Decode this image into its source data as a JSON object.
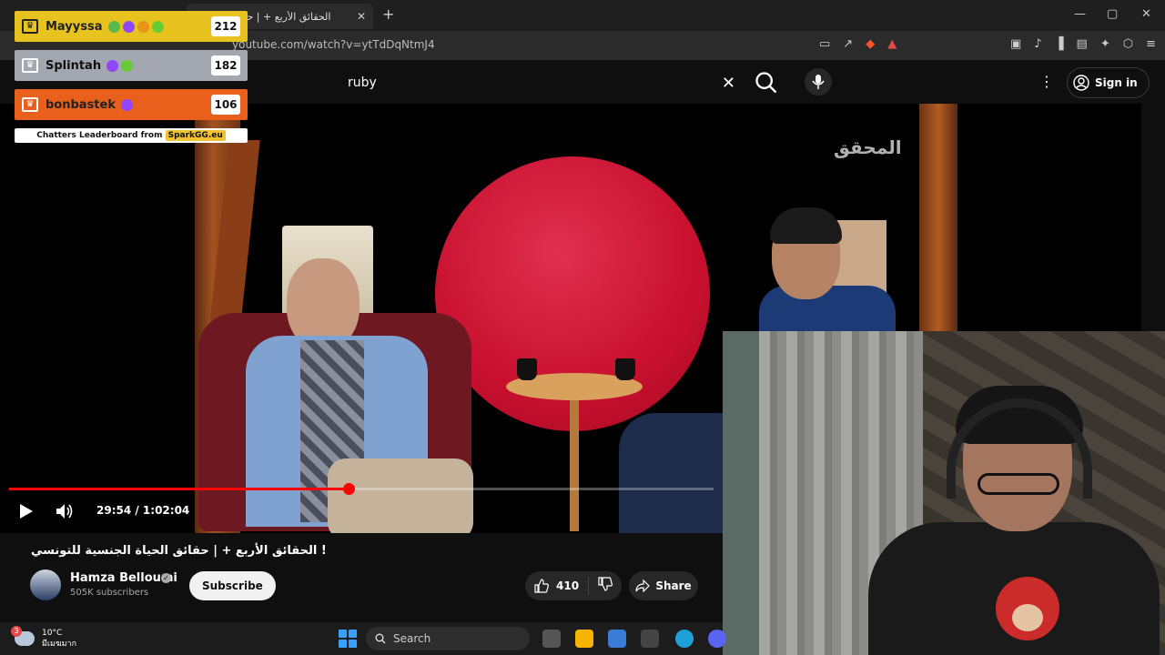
{
  "browser": {
    "tab_title": "! الحقائق الأربع + | حقائق الحياة",
    "tab_close": "✕",
    "new_tab": "+",
    "url": "youtube.com/watch?v=ytTdDqNtmJ4",
    "window_controls": {
      "minimize": "—",
      "maximize": "▢",
      "close": "✕"
    }
  },
  "youtube": {
    "search_value": "ruby",
    "search_placeholder": "Search",
    "sign_in": "Sign in"
  },
  "player": {
    "time": "29:54 / 1:02:04",
    "progress_fraction": 0.482,
    "watermark": "المحقق"
  },
  "video": {
    "title": "الحقائق الأربع + | حقائق الحياة الجنسية للتونسي !",
    "channel_name": "Hamza Belloumi",
    "subscribers": "505K subscribers",
    "subscribe_label": "Subscribe",
    "likes": "410",
    "share_label": "Share"
  },
  "leaderboard": {
    "rows": [
      {
        "name": "Mayyssa",
        "score": "212",
        "color": "#e8c21e"
      },
      {
        "name": "Splintah",
        "score": "182",
        "color": "#a3a7b0"
      },
      {
        "name": "bonbastek",
        "score": "106",
        "color": "#e8601c"
      }
    ],
    "footer_text": "Chatters Leaderboard from ",
    "footer_brand": "SparkGG.eu"
  },
  "taskbar": {
    "weather_temp": "10°C",
    "weather_desc": "มีเมฆมาก",
    "weather_badge": "3",
    "search_label": "Search"
  },
  "colors": {
    "accent_red": "#ff0000",
    "yt_bg": "#0f0f0f"
  }
}
